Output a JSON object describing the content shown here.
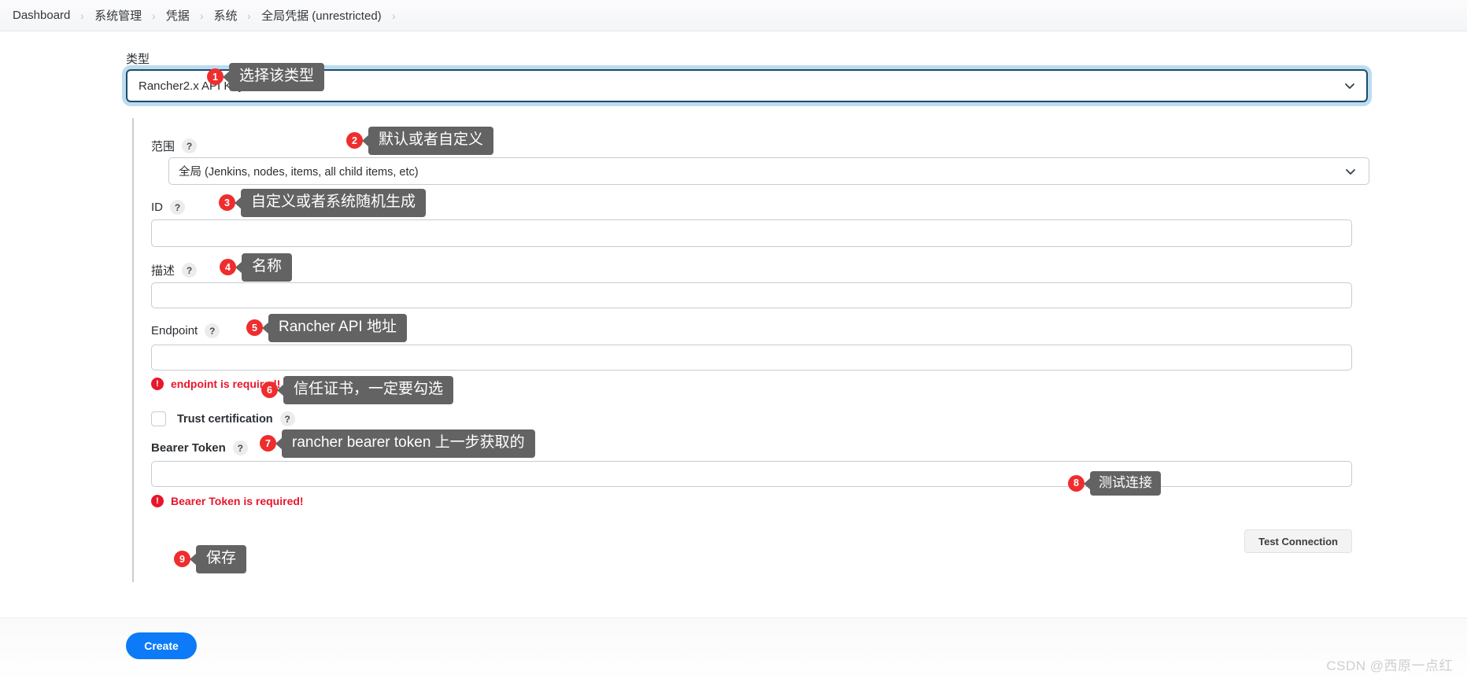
{
  "breadcrumb": {
    "separator": "›",
    "items": [
      {
        "label": "Dashboard"
      },
      {
        "label": "系统管理"
      },
      {
        "label": "凭据"
      },
      {
        "label": "系统"
      },
      {
        "label": "全局凭据 (unrestricted)"
      }
    ]
  },
  "form": {
    "type": {
      "label": "类型",
      "value": "Rancher2.x API Keys"
    },
    "scope": {
      "label": "范围",
      "help": "?",
      "value": "全局 (Jenkins, nodes, items, all child items, etc)"
    },
    "id": {
      "label": "ID",
      "help": "?",
      "value": ""
    },
    "description": {
      "label": "描述",
      "help": "?",
      "value": ""
    },
    "endpoint": {
      "label": "Endpoint",
      "help": "?",
      "value": "",
      "error": "endpoint is required! eg: http://192.168.0.2/v3",
      "error_icon": "!"
    },
    "trust_certification": {
      "label": "Trust certification",
      "help": "?",
      "checked": false
    },
    "bearer_token": {
      "label": "Bearer Token",
      "help": "?",
      "value": "",
      "error": "Bearer Token is required!",
      "error_icon": "!"
    },
    "test_connection": {
      "label": "Test Connection"
    }
  },
  "footer": {
    "create_label": "Create",
    "watermark": "CSDN @西原一点红"
  },
  "annotations": [
    {
      "num": "1",
      "text": "选择该类型"
    },
    {
      "num": "2",
      "text": "默认或者自定义"
    },
    {
      "num": "3",
      "text": "自定义或者系统随机生成"
    },
    {
      "num": "4",
      "text": "名称"
    },
    {
      "num": "5",
      "text": "Rancher API 地址"
    },
    {
      "num": "6",
      "text": "信任证书，一定要勾选"
    },
    {
      "num": "7",
      "text": "rancher bearer token 上一步获取的"
    },
    {
      "num": "8",
      "text": "测试连接"
    },
    {
      "num": "9",
      "text": "保存"
    }
  ],
  "colors": {
    "accent": "#0d7bf7",
    "error": "#e8162c",
    "anno_red": "#ef2d2d",
    "anno_gray": "#636363",
    "focus_ring": "#bcdcf0",
    "focus_border": "#1d4a6b"
  }
}
